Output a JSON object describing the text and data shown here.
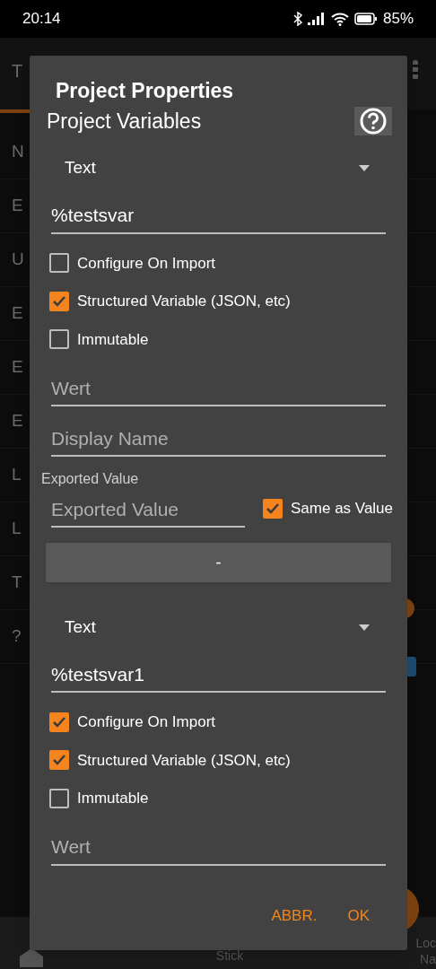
{
  "status_bar": {
    "time": "20:14",
    "battery": "85%"
  },
  "background": {
    "app_title": "T",
    "row_initials": [
      "N",
      "E",
      "U",
      "E",
      "E",
      "E",
      "L",
      "L",
      "T",
      "?"
    ],
    "toggle_on": true,
    "bottom_nav": {
      "center_label": "Stick",
      "right_label_lines": [
        "Loc",
        "Na"
      ]
    }
  },
  "dialog": {
    "title": "Project Properties",
    "section_title": "Project Variables",
    "variables": [
      {
        "type": "Text",
        "name": "%testsvar",
        "options": [
          {
            "label": "Configure On Import",
            "checked": false
          },
          {
            "label": "Structured Variable (JSON, etc)",
            "checked": true
          },
          {
            "label": "Immutable",
            "checked": false
          }
        ],
        "value_placeholder": "Wert",
        "display_name_placeholder": "Display Name",
        "exported_value_label": "Exported Value",
        "exported_value_placeholder": "Exported Value",
        "same_as_value": {
          "label": "Same as Value",
          "checked": true
        },
        "remove_button": "-"
      },
      {
        "type": "Text",
        "name": "%testsvar1",
        "options": [
          {
            "label": "Configure On Import",
            "checked": true
          },
          {
            "label": "Structured Variable (JSON, etc)",
            "checked": true
          },
          {
            "label": "Immutable",
            "checked": false
          }
        ],
        "value_placeholder": "Wert"
      }
    ],
    "buttons": [
      "ABBR.",
      "OK"
    ]
  }
}
